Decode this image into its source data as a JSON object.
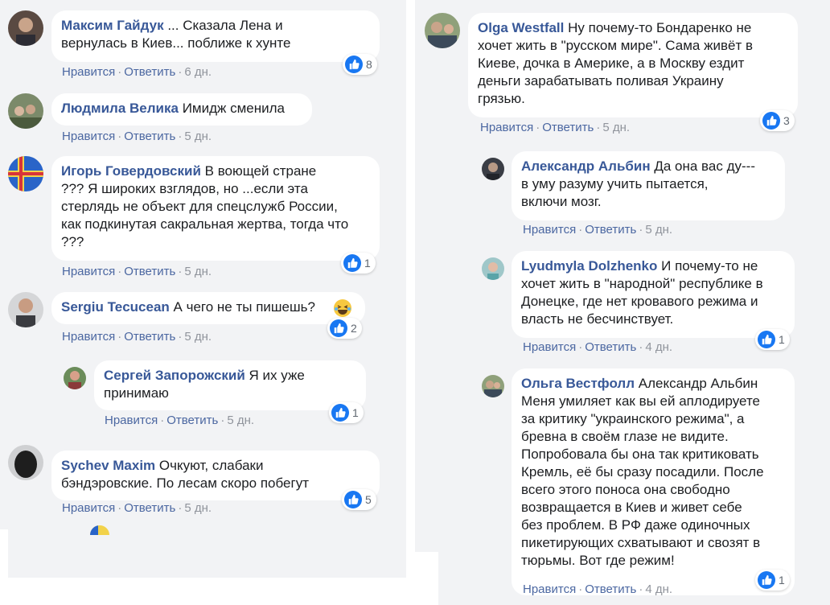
{
  "actions": {
    "like": "Нравится",
    "reply": "Ответить",
    "sep": "·"
  },
  "colors": {
    "author": "#385898",
    "link": "#4b67a1",
    "meta": "#90949c",
    "like_blue": "#1877f2",
    "bubble": "#ffffff",
    "panel": "#f2f3f5"
  },
  "icons": {
    "like": "thumbs-up-icon",
    "haha": "laughing-emoji-icon"
  },
  "left_column": [
    {
      "author": "Максим Гайдук",
      "text": " ... Сказала Лена и\nвернулась в Киев... поближе к хунте",
      "age": "6 дн.",
      "likes": "8"
    },
    {
      "author": "Людмила Велика",
      "text": " Имидж сменила",
      "age": "5 дн.",
      "likes": ""
    },
    {
      "author": "Игорь Говердовский",
      "text": " В воющей стране\n??? Я широких взглядов, но ...если эта\nстерлядь не объект для спецслужб России,\nкак подкинутая сакральная жертва, тогда что\n???",
      "age": "5 дн.",
      "likes": "1"
    },
    {
      "author": "Sergiu Tecucean",
      "text": " А чего не ты пишешь?",
      "age": "5 дн.",
      "likes": "2"
    },
    {
      "author": "Сергей Запорожский",
      "text": " Я их уже\nпринимаю",
      "age": "5 дн.",
      "likes": "1"
    },
    {
      "author": "Sychev Maxim",
      "text": " Очкуют, слабаки\nбэндэровские. По лесам скоро побегут",
      "age": "5 дн.",
      "likes": "5"
    }
  ],
  "right_column": [
    {
      "author": "Olga Westfall",
      "text": " Ну почему-то Бондаренко не\nхочет жить в \"русском мире\". Сама живёт в\nКиеве, дочка в Америке, а в Москву ездит\nденьги зарабатывать поливая Украину\nгрязью.",
      "age": "5 дн.",
      "likes": "3"
    },
    {
      "author": "Александр Альбин",
      "text": " Да она вас ду---\nв уму разуму учить пытается,\nвключи мозг.",
      "age": "5 дн.",
      "likes": ""
    },
    {
      "author": "Lyudmyla Dolzhenko",
      "text": " И почему-то не\nхочет жить в \"народной\" республике в\nДонецке, где нет кровавого режима и\nвласть не бесчинствует.",
      "age": "4 дн.",
      "likes": "1"
    },
    {
      "author": "Ольга Вестфолл",
      "text": " Александр Альбин\nМеня умиляет как вы ей аплодируете\nза критику \"украинского режима\", а\nбревна в своём глазе не видите.\nПопробовала бы она так критиковать\nКремль, её бы сразу посадили. После\nвсего этого поноса она свободно\nвозвращается в Киев и живет себе\nбез проблем. В РФ даже одиночных\nпикетирующих схватывают и свозят в\nтюрьмы. Вот где режим!",
      "age": "4 дн.",
      "likes": "1"
    }
  ]
}
